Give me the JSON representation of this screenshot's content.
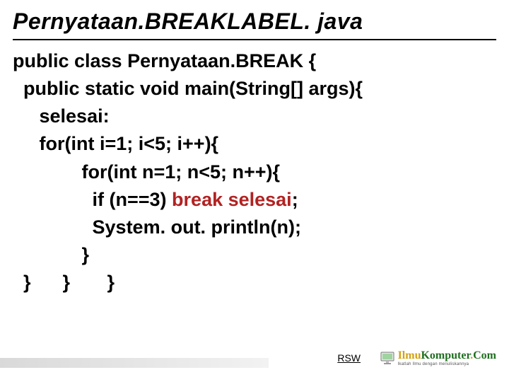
{
  "title": "Pernyataan.BREAKLABEL. java",
  "code": {
    "l1": "public class Pernyataan.BREAK {",
    "l2": "  public static void main(String[] args){",
    "l3": "     selesai:",
    "l4": "     for(int i=1; i<5; i++){",
    "l5_pre": "             for(int n=1; n<5; n++){",
    "l6_pre": "               if (n==3) ",
    "l6_hl": "break selesai",
    "l6_post": ";",
    "l7": "               System. out. println(n);",
    "l8": "             }",
    "l9": "  }      }       }"
  },
  "footer": {
    "rsw": "RSW",
    "logo_main_ilmu": "Ilmu",
    "logo_main_komputer": "Komputer",
    "logo_main_dot": ".",
    "logo_main_com": "Com",
    "logo_sub": "Ikatlah Ilmu dengan menuliskannya"
  }
}
